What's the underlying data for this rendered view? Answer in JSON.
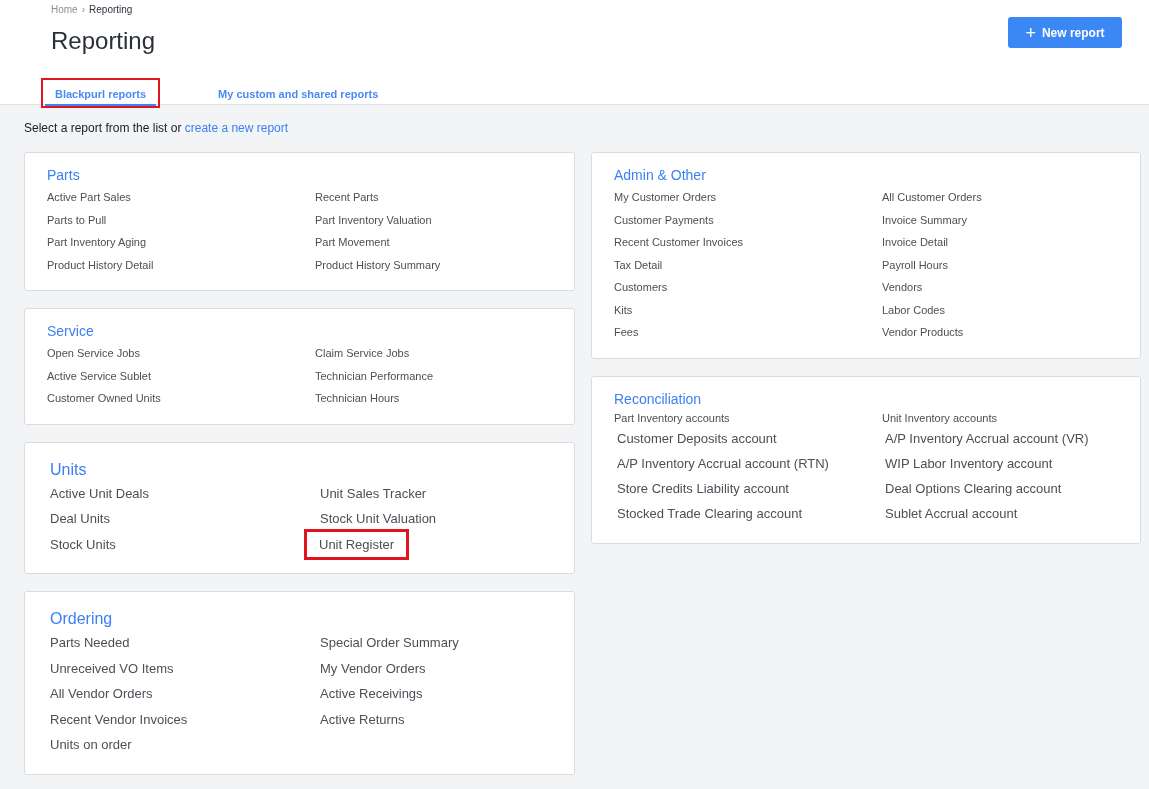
{
  "breadcrumb": {
    "home": "Home",
    "separator": "›",
    "current": "Reporting"
  },
  "title": "Reporting",
  "new_button": {
    "icon": "+",
    "label": "New report"
  },
  "tabs": [
    {
      "label": "Blackpurl reports",
      "selected": true,
      "highlighted": true
    },
    {
      "label": "My custom and shared reports",
      "selected": false,
      "highlighted": false
    }
  ],
  "intro": {
    "text": "Select a report from the list or",
    "link": "create a new report"
  },
  "left_cards": [
    {
      "title": "Parts",
      "kind": "compact",
      "columns": [
        [
          {
            "label": "Active Part Sales",
            "highlighted": false
          },
          {
            "label": "Parts to Pull",
            "highlighted": false
          },
          {
            "label": "Part Inventory Aging",
            "highlighted": false
          },
          {
            "label": "Product History Detail",
            "highlighted": false
          }
        ],
        [
          {
            "label": "Recent Parts",
            "highlighted": false
          },
          {
            "label": "Part Inventory Valuation",
            "highlighted": false
          },
          {
            "label": "Part Movement",
            "highlighted": false
          },
          {
            "label": "Product History Summary",
            "highlighted": false
          }
        ]
      ]
    },
    {
      "title": "Service",
      "kind": "compact",
      "columns": [
        [
          {
            "label": "Open Service Jobs",
            "highlighted": false
          },
          {
            "label": "Active Service Sublet",
            "highlighted": false
          },
          {
            "label": "Customer Owned Units",
            "highlighted": false
          }
        ],
        [
          {
            "label": "Claim Service Jobs",
            "highlighted": false
          },
          {
            "label": "Technician Performance",
            "highlighted": false
          },
          {
            "label": "Technician Hours",
            "highlighted": false
          }
        ]
      ]
    },
    {
      "title": "Units",
      "kind": "large",
      "columns": [
        [
          {
            "label": "Active Unit Deals",
            "highlighted": false
          },
          {
            "label": "Deal Units",
            "highlighted": false
          },
          {
            "label": "Stock Units",
            "highlighted": false
          }
        ],
        [
          {
            "label": "Unit Sales Tracker",
            "highlighted": false
          },
          {
            "label": "Stock Unit Valuation",
            "highlighted": false
          },
          {
            "label": "Unit Register",
            "highlighted": true
          }
        ]
      ]
    },
    {
      "title": "Ordering",
      "kind": "large",
      "columns": [
        [
          {
            "label": "Parts Needed",
            "highlighted": false
          },
          {
            "label": "Unreceived VO Items",
            "highlighted": false
          },
          {
            "label": "All Vendor Orders",
            "highlighted": false
          },
          {
            "label": "Recent Vendor Invoices",
            "highlighted": false
          },
          {
            "label": "Units on order",
            "highlighted": false
          }
        ],
        [
          {
            "label": "Special Order Summary",
            "highlighted": false
          },
          {
            "label": "My Vendor Orders",
            "highlighted": false
          },
          {
            "label": "Active Receivings",
            "highlighted": false
          },
          {
            "label": "Active Returns",
            "highlighted": false
          }
        ]
      ]
    }
  ],
  "right_cards": [
    {
      "title": "Admin & Other",
      "kind": "compact",
      "columns": [
        [
          {
            "label": "My Customer Orders",
            "highlighted": false
          },
          {
            "label": "Customer Payments",
            "highlighted": false
          },
          {
            "label": "Recent Customer Invoices",
            "highlighted": false
          },
          {
            "label": "Tax Detail",
            "highlighted": false
          },
          {
            "label": "Customers",
            "highlighted": false
          },
          {
            "label": "Kits",
            "highlighted": false
          },
          {
            "label": "Fees",
            "highlighted": false
          }
        ],
        [
          {
            "label": "All Customer Orders",
            "highlighted": false
          },
          {
            "label": "Invoice Summary",
            "highlighted": false
          },
          {
            "label": "Invoice Detail",
            "highlighted": false
          },
          {
            "label": "Payroll Hours",
            "highlighted": false
          },
          {
            "label": "Vendors",
            "highlighted": false
          },
          {
            "label": "Labor Codes",
            "highlighted": false
          },
          {
            "label": "Vendor Products",
            "highlighted": false
          }
        ]
      ]
    },
    {
      "title": "Reconciliation",
      "kind": "grouped",
      "groups": [
        {
          "heading": "Part Inventory accounts",
          "links": [
            {
              "label": "Customer Deposits account",
              "highlighted": false
            },
            {
              "label": "A/P Inventory Accrual account (RTN)",
              "highlighted": false
            },
            {
              "label": "Store Credits Liability account",
              "highlighted": false
            },
            {
              "label": "Stocked Trade Clearing account",
              "highlighted": false
            }
          ]
        },
        {
          "heading": "Unit Inventory accounts",
          "links": [
            {
              "label": "A/P Inventory Accrual account (VR)",
              "highlighted": false
            },
            {
              "label": "WIP Labor Inventory account",
              "highlighted": false
            },
            {
              "label": "Deal Options Clearing account",
              "highlighted": false
            },
            {
              "label": "Sublet Accrual account",
              "highlighted": false
            }
          ]
        }
      ]
    }
  ]
}
